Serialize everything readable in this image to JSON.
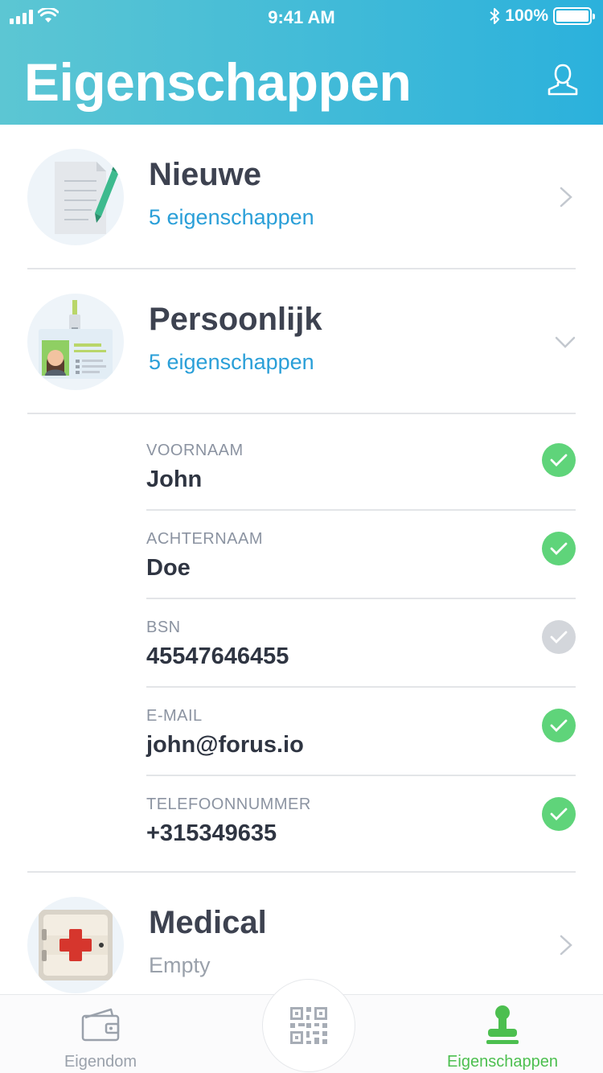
{
  "status_bar": {
    "time": "9:41 AM",
    "battery": "100%"
  },
  "header": {
    "title": "Eigenschappen",
    "profile_icon": "user-icon"
  },
  "categories": [
    {
      "title": "Nieuwe",
      "subtitle": "5 eigenschappen",
      "icon": "document-pen-icon",
      "state": "collapsed"
    },
    {
      "title": "Persoonlijk",
      "subtitle": "5 eigenschappen",
      "icon": "id-badge-icon",
      "state": "expanded"
    },
    {
      "title": "Medical",
      "subtitle": "Empty",
      "icon": "first-aid-kit-icon",
      "state": "collapsed"
    }
  ],
  "properties": [
    {
      "label": "VOORNAAM",
      "value": "John",
      "verified": true
    },
    {
      "label": "ACHTERNAAM",
      "value": "Doe",
      "verified": true
    },
    {
      "label": "BSN",
      "value": "45547646455",
      "verified": false
    },
    {
      "label": "E-MAIL",
      "value": "john@forus.io",
      "verified": true
    },
    {
      "label": "TELEFOONNUMMER",
      "value": "+315349635",
      "verified": true
    }
  ],
  "tabbar": {
    "tabs": [
      {
        "label": "Eigendom",
        "icon": "wallet-icon",
        "active": false
      },
      {
        "label": "",
        "icon": "qr-code-icon",
        "active": false
      },
      {
        "label": "Eigenschappen",
        "icon": "stamp-icon",
        "active": true
      }
    ]
  },
  "colors": {
    "header_gradient_start": "#5cc6d3",
    "header_gradient_end": "#2bb1dc",
    "accent_blue": "#2a9fd8",
    "verified_green": "#5fd47a",
    "unverified_gray": "#d3d6db",
    "active_tab": "#4cbf4f",
    "inactive_tab": "#9aa1ab"
  }
}
